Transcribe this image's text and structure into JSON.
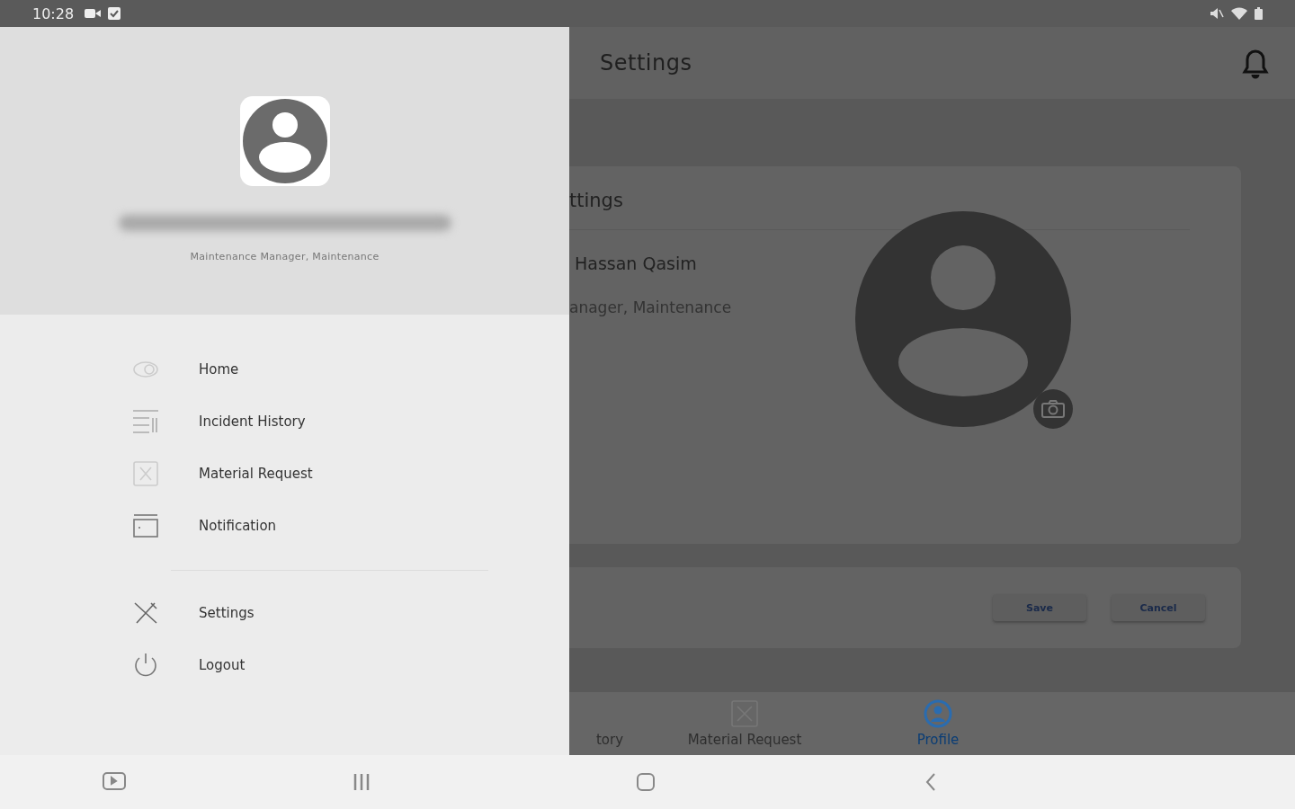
{
  "status_bar": {
    "time": "10:28"
  },
  "drawer": {
    "role": "Maintenance Manager, Maintenance",
    "menu": [
      {
        "label": "Home",
        "kind": "home"
      },
      {
        "label": "Incident History",
        "kind": "history"
      },
      {
        "label": "Material Request",
        "kind": "material"
      },
      {
        "label": "Notification",
        "kind": "notification"
      }
    ],
    "footer_menu": [
      {
        "label": "Settings",
        "kind": "settings"
      },
      {
        "label": "Logout",
        "kind": "logout"
      }
    ]
  },
  "screen": {
    "title": "Settings",
    "card_title": "ttings",
    "name": "Hassan Qasim",
    "role": "anager, Maintenance",
    "buttons": [
      "Save",
      "Cancel"
    ],
    "bottom_nav": [
      {
        "label": "tory",
        "kind": "history",
        "selected": false
      },
      {
        "label": "Material Request",
        "kind": "material",
        "selected": false
      },
      {
        "label": "Profile",
        "kind": "profile",
        "selected": true
      }
    ]
  }
}
